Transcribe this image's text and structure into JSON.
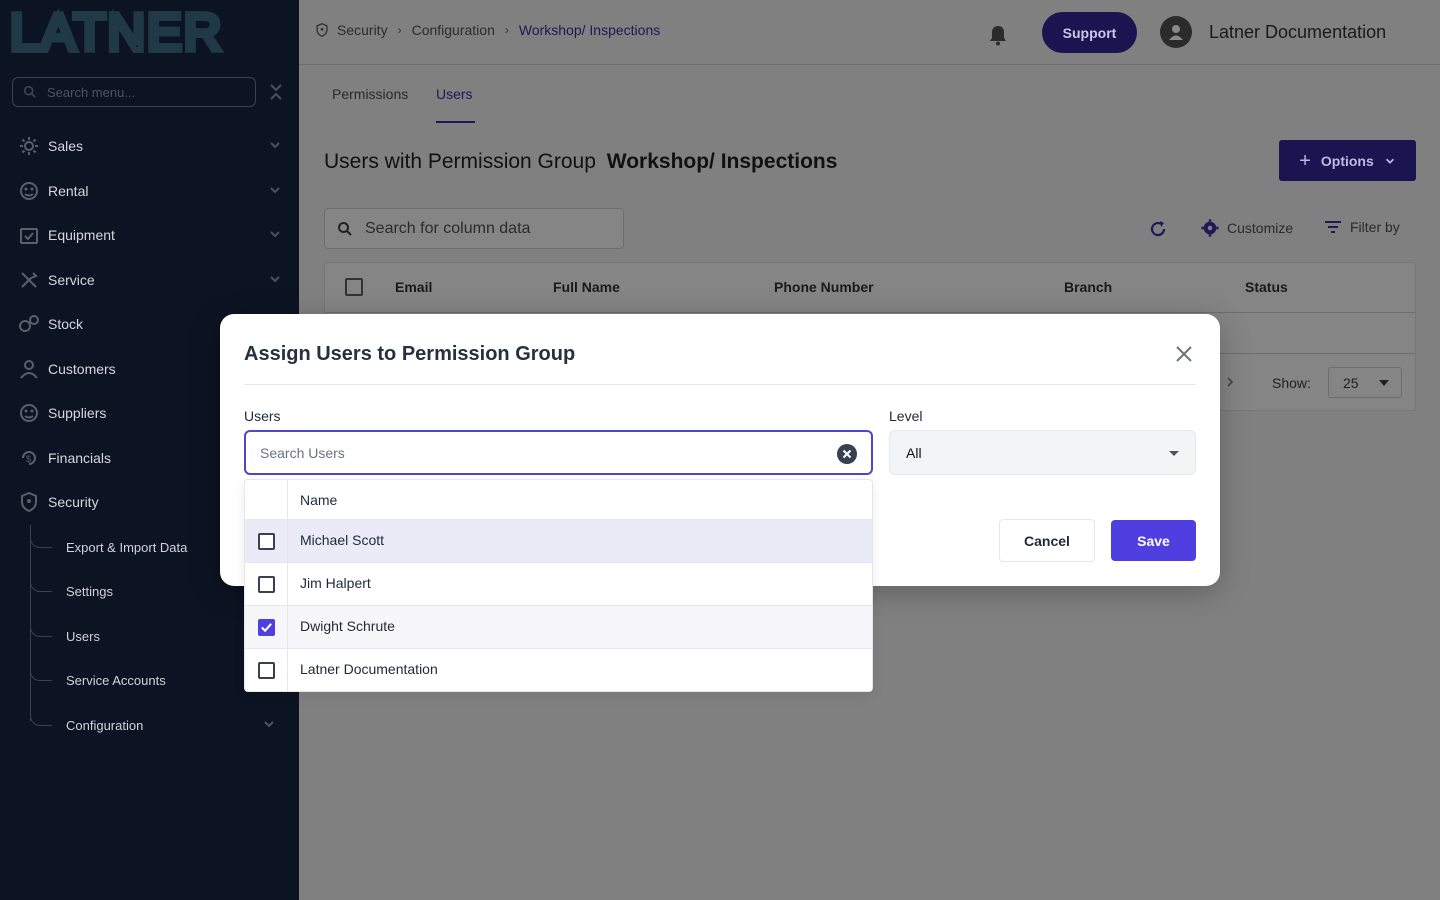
{
  "app": {
    "logo_text": "LATNER"
  },
  "sidebar": {
    "search_placeholder": "Search menu...",
    "items": [
      {
        "label": "Sales",
        "icon": "sales-icon",
        "has_children": true
      },
      {
        "label": "Rental",
        "icon": "rental-icon",
        "has_children": true
      },
      {
        "label": "Equipment",
        "icon": "equipment-icon",
        "has_children": true
      },
      {
        "label": "Service",
        "icon": "service-icon",
        "has_children": true
      },
      {
        "label": "Stock",
        "icon": "stock-icon",
        "has_children": false
      },
      {
        "label": "Customers",
        "icon": "customers-icon",
        "has_children": false
      },
      {
        "label": "Suppliers",
        "icon": "suppliers-icon",
        "has_children": false
      },
      {
        "label": "Financials",
        "icon": "financials-icon",
        "has_children": false
      },
      {
        "label": "Security",
        "icon": "shield-icon",
        "has_children": false
      }
    ],
    "security_children": [
      {
        "label": "Export & Import Data"
      },
      {
        "label": "Settings"
      },
      {
        "label": "Users"
      },
      {
        "label": "Service Accounts"
      },
      {
        "label": "Configuration",
        "has_children": true
      }
    ]
  },
  "header": {
    "breadcrumb": [
      "Security",
      "Configuration",
      "Workshop/ Inspections"
    ],
    "support_label": "Support",
    "user_name": "Latner Documentation"
  },
  "tabs": [
    {
      "label": "Permissions",
      "active": false
    },
    {
      "label": "Users",
      "active": true
    }
  ],
  "page": {
    "title_prefix": "Users with Permission Group",
    "title_group": "Workshop/ Inspections",
    "options_label": "Options"
  },
  "table": {
    "search_placeholder": "Search for column data",
    "customize_label": "Customize",
    "filter_label": "Filter by",
    "columns": [
      "Email",
      "Full Name",
      "Phone Number",
      "Branch",
      "Status"
    ],
    "show_label": "Show:",
    "page_size": "25"
  },
  "modal": {
    "title": "Assign Users to Permission Group",
    "users_label": "Users",
    "users_placeholder": "Search Users",
    "level_label": "Level",
    "level_value": "All",
    "cancel_label": "Cancel",
    "save_label": "Save",
    "list_header": "Name",
    "users": [
      {
        "name": "Michael Scott",
        "checked": false
      },
      {
        "name": "Jim Halpert",
        "checked": false
      },
      {
        "name": "Dwight Schrute",
        "checked": true
      },
      {
        "name": "Latner Documentation",
        "checked": false
      }
    ]
  },
  "colors": {
    "sidebar_bg": "#0c1322",
    "accent": "#4f3fe0",
    "overlay": "#808080"
  }
}
